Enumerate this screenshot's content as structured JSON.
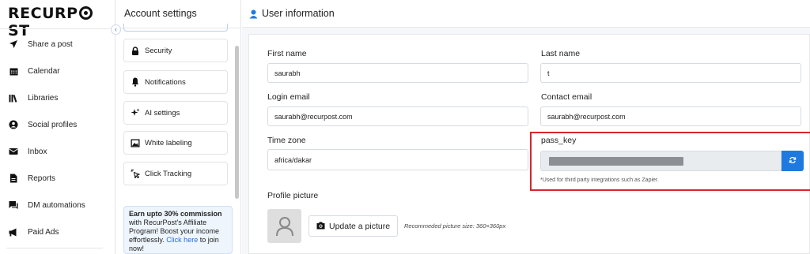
{
  "brand": {
    "logo_left": "REC",
    "logo_mid": "URP",
    "logo_right": "ST"
  },
  "nav": {
    "items": [
      {
        "label": "Share a post",
        "icon": "send-icon"
      },
      {
        "label": "Calendar",
        "icon": "calendar-icon"
      },
      {
        "label": "Libraries",
        "icon": "libraries-icon"
      },
      {
        "label": "Social profiles",
        "icon": "user-circle-icon"
      },
      {
        "label": "Inbox",
        "icon": "envelope-icon"
      },
      {
        "label": "Reports",
        "icon": "report-icon"
      },
      {
        "label": "DM automations",
        "icon": "chat-icon"
      },
      {
        "label": "Paid Ads",
        "icon": "megaphone-icon"
      }
    ]
  },
  "settings": {
    "title": "Account settings",
    "collapse_icon": "chevron-left-icon",
    "menu": [
      {
        "label": "Security",
        "icon": "lock-icon"
      },
      {
        "label": "Notifications",
        "icon": "bell-icon"
      },
      {
        "label": "AI settings",
        "icon": "sparkle-icon"
      },
      {
        "label": "White labeling",
        "icon": "image-icon"
      },
      {
        "label": "Click Tracking",
        "icon": "cursor-click-icon"
      }
    ],
    "promo": {
      "bold": "Earn upto 30% commission",
      "line1": " with RecurPost's Affiliate Program! Boost your income effortlessly. ",
      "link": "Click here",
      "line2": " to join now!"
    }
  },
  "main": {
    "title": "User information",
    "title_icon": "user-icon",
    "first_name": {
      "label": "First name",
      "value": "saurabh"
    },
    "last_name": {
      "label": "Last name",
      "value": "t"
    },
    "login_email": {
      "label": "Login email",
      "value": "saurabh@recurpost.com"
    },
    "contact_email": {
      "label": "Contact email",
      "value": "saurabh@recurpost.com"
    },
    "time_zone": {
      "label": "Time zone",
      "value": "africa/dakar"
    },
    "pass_key": {
      "label": "pass_key",
      "help": "*Used for third party integrations such as Zapier.",
      "refresh_icon": "refresh-icon"
    },
    "profile_picture": {
      "label": "Profile picture",
      "button": "Update a picture",
      "button_icon": "camera-icon",
      "recommendation": "Recommeded picture size: 360×360px"
    }
  },
  "colors": {
    "accent": "#1f7ae0",
    "highlight": "#d7262d",
    "promo_bg": "#eef5fd"
  }
}
